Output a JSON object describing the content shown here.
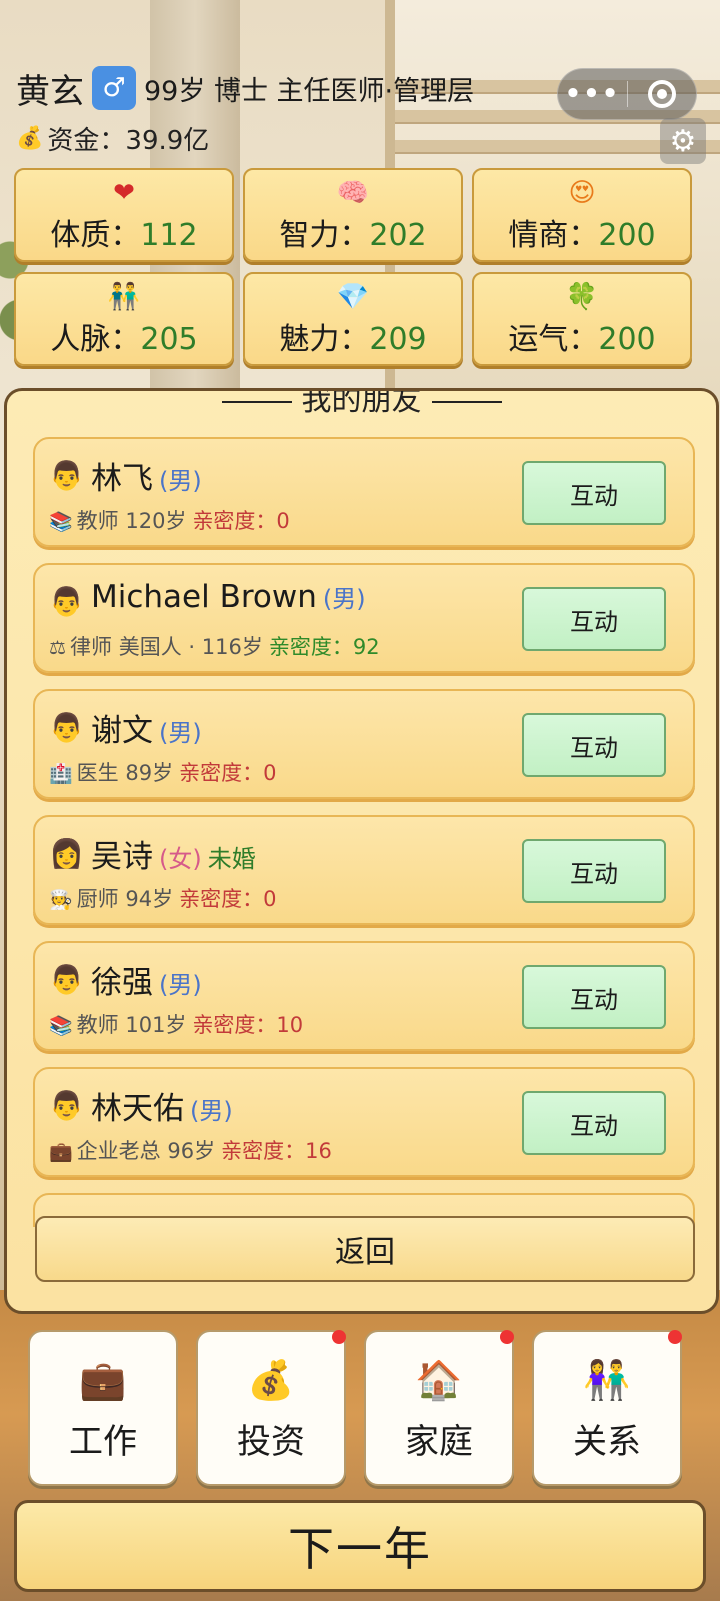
{
  "header": {
    "name": "黄玄",
    "gender_symbol": "♂",
    "profile": "99岁 博士 主任医师·管理层",
    "money": "资金：39.9亿"
  },
  "capsule": {
    "more": "•••"
  },
  "stats": [
    {
      "label": "体质：",
      "value": "112",
      "icon": "heart-icon",
      "glyph": "❤"
    },
    {
      "label": "智力：",
      "value": "202",
      "icon": "brain-icon",
      "glyph": "🧠"
    },
    {
      "label": "情商：",
      "value": "200",
      "icon": "smile-heart-icon",
      "glyph": "😍"
    },
    {
      "label": "人脉：",
      "value": "205",
      "icon": "people-icon",
      "glyph": "👬"
    },
    {
      "label": "魅力：",
      "value": "209",
      "icon": "gem-icon",
      "glyph": "💎"
    },
    {
      "label": "运气：",
      "value": "200",
      "icon": "clover-icon",
      "glyph": "🍀"
    }
  ],
  "friends": {
    "title": "我的朋友",
    "interact_label": "互动",
    "items": [
      {
        "avatar": "👨",
        "name": "林飞",
        "gender": "(男)",
        "marital": "",
        "job_icon": "📚",
        "info": "教师 120岁",
        "closeness": "亲密度：0"
      },
      {
        "avatar": "👨",
        "name": "Michael Brown",
        "gender": "(男)",
        "marital": "",
        "job_icon": "⚖",
        "info": "律师 美国人 · 116岁",
        "closeness": "亲密度：92"
      },
      {
        "avatar": "👨",
        "name": "谢文",
        "gender": "(男)",
        "marital": "",
        "job_icon": "🏥",
        "info": "医生 89岁",
        "closeness": "亲密度：0"
      },
      {
        "avatar": "👩",
        "name": "吴诗",
        "gender": "(女)",
        "marital": "未婚",
        "job_icon": "🧑‍🍳",
        "info": "厨师 94岁",
        "closeness": "亲密度：0"
      },
      {
        "avatar": "👨",
        "name": "徐强",
        "gender": "(男)",
        "marital": "",
        "job_icon": "📚",
        "info": "教师 101岁",
        "closeness": "亲密度：10"
      },
      {
        "avatar": "👨",
        "name": "林天佑",
        "gender": "(男)",
        "marital": "",
        "job_icon": "💼",
        "info": "企业老总 96岁",
        "closeness": "亲密度：16"
      }
    ],
    "back_label": "返回"
  },
  "nav": [
    {
      "label": "工作",
      "icon": "briefcase-icon",
      "glyph": "💼",
      "badge": false
    },
    {
      "label": "投资",
      "icon": "money-bag-icon",
      "glyph": "💰",
      "badge": true
    },
    {
      "label": "家庭",
      "icon": "house-icon",
      "glyph": "🏠",
      "badge": true
    },
    {
      "label": "关系",
      "icon": "couple-icon",
      "glyph": "👫",
      "badge": true
    }
  ],
  "next_year": "下一年",
  "colors": {
    "stat_value": "#2f7d2a",
    "closeness_low": "#c23a3a",
    "closeness_high": "#2f8a2a",
    "interact_bg": "#c2f0c4"
  }
}
